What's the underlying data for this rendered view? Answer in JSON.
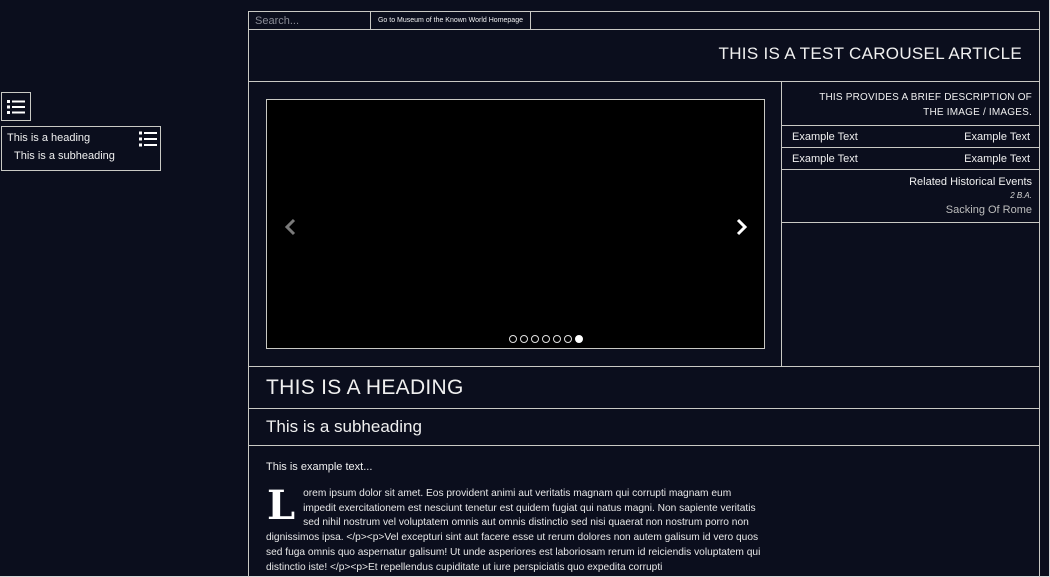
{
  "toc": {
    "toggle_icon": "list-icon",
    "heading": "This is a heading",
    "subheading": "This is a subheading"
  },
  "topbar": {
    "search_placeholder": "Search...",
    "home_link": "Go to Museum of the Known World Homepage"
  },
  "page_title": "THIS IS A TEST CAROUSEL ARTICLE",
  "carousel": {
    "slide_count": 7,
    "active_slide": 7,
    "prev_icon": "chevron-left-icon",
    "next_icon": "chevron-right-icon"
  },
  "side": {
    "description": "THIS PROVIDES A BRIEF DESCRIPTION OF THE IMAGE / IMAGES.",
    "rows": [
      {
        "left": "Example Text",
        "right": "Example Text"
      },
      {
        "left": "Example Text",
        "right": "Example Text"
      }
    ],
    "related": {
      "heading": "Related Historical Events",
      "date": "2 B.A.",
      "event": "Sacking Of Rome"
    }
  },
  "heading": "THIS IS A HEADING",
  "subheading": "This is a subheading",
  "body": {
    "intro": "This is example text...",
    "dropcap": "L",
    "text": "orem ipsum dolor sit amet. Eos provident animi aut veritatis magnam qui corrupti magnam eum impedit exercitationem est nesciunt tenetur est quidem fugiat qui natus magni. Non sapiente veritatis sed nihil nostrum vel voluptatem omnis aut omnis distinctio sed nisi quaerat non nostrum porro non dignissimos ipsa. </p><p>Vel excepturi sint aut facere esse ut rerum dolores non autem galisum id vero quos sed fuga omnis quo aspernatur galisum! Ut unde asperiores est laboriosam rerum id reiciendis voluptatem qui distinctio iste! </p><p>Et repellendus cupiditate ut iure perspiciatis quo expedita corrupti"
  }
}
